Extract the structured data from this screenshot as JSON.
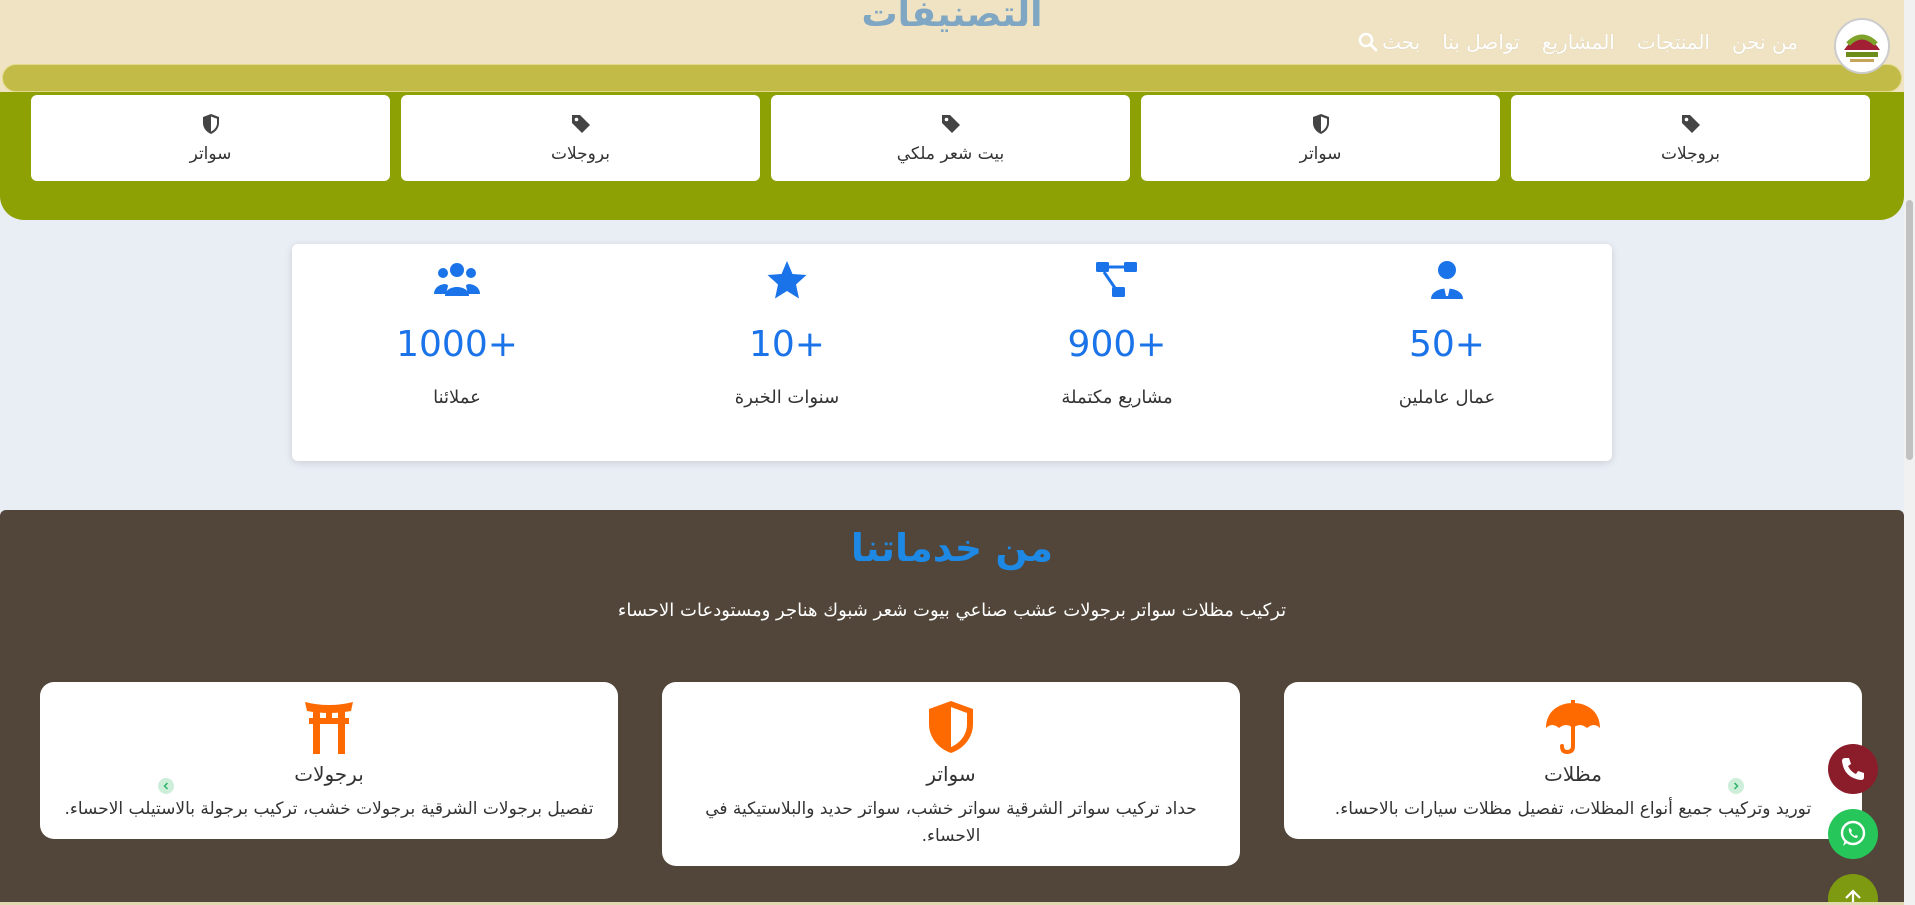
{
  "header": {
    "page_title": "التصنيفات",
    "nav": [
      {
        "label": "من نحن"
      },
      {
        "label": "المنتجات"
      },
      {
        "label": "المشاريع"
      },
      {
        "label": "تواصل بنا"
      }
    ],
    "search_label": "بحث"
  },
  "categories": [
    {
      "label": "بروجلات",
      "icon": "tag-icon"
    },
    {
      "label": "سواتر",
      "icon": "shield-icon"
    },
    {
      "label": "بيت شعر ملكي",
      "icon": "tag-icon"
    },
    {
      "label": "بروجلات",
      "icon": "tag-icon"
    },
    {
      "label": "سواتر",
      "icon": "shield-icon"
    }
  ],
  "stats": [
    {
      "num": "50+",
      "label": "عمال عاملين",
      "icon": "user-tie-icon"
    },
    {
      "num": "900+",
      "label": "مشاريع مكتملة",
      "icon": "project-diagram-icon"
    },
    {
      "num": "10+",
      "label": "سنوات الخبرة",
      "icon": "star-icon"
    },
    {
      "num": "1000+",
      "label": "عملائنا",
      "icon": "users-icon"
    }
  ],
  "services": {
    "title": "من خدماتنا",
    "subtitle": "تركيب مظلات سواتر برجولات عشب صناعي بيوت شعر شبوك هناجر ومستودعات الاحساء",
    "cards": [
      {
        "name": "مظلات",
        "desc": "توريد وتركيب جميع أنواع المظلات، تفصيل مظلات سيارات بالاحساء.",
        "icon": "umbrella-icon"
      },
      {
        "name": "سواتر",
        "desc": "حداد تركيب سواتر الشرقية سواتر خشب، سواتر حديد والبلاستيكية في الاحساء.",
        "icon": "shield-halved-icon"
      },
      {
        "name": "برجولات",
        "desc": "تفصيل برجولات الشرقية برجولات خشب، تركيب برجولة بالاستيلب الاحساء.",
        "icon": "torii-gate-icon"
      }
    ]
  },
  "colors": {
    "header_bg": "#efe3c3",
    "categories_bg": "#8da105",
    "services_bg": "#514639",
    "accent_blue": "#1a73e8",
    "service_icon": "#ff6a00"
  }
}
